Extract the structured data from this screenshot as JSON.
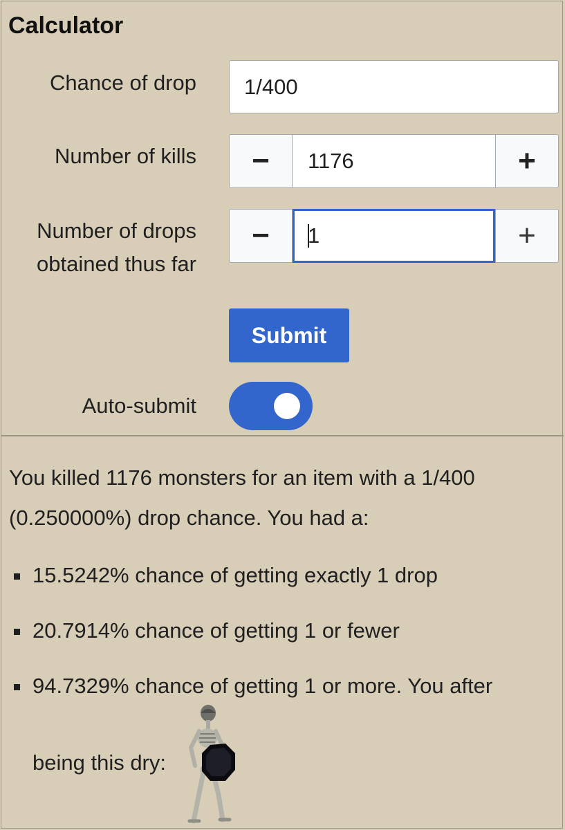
{
  "title": "Calculator",
  "form": {
    "chance_label": "Chance of drop",
    "chance_value": "1/400",
    "kills_label": "Number of kills",
    "kills_value": "1176",
    "drops_label_line1": "Number of drops",
    "drops_label_line2": "obtained thus far",
    "drops_value": "1",
    "minus_glyph": "−",
    "plus_glyph": "+",
    "submit_label": "Submit",
    "autosubmit_label": "Auto-submit",
    "autosubmit_on": true,
    "accent_color": "#3366cc"
  },
  "result": {
    "intro_line1": "You killed 1176 monsters for an item with a 1/400",
    "intro_line2": "(0.250000%) drop chance. You had a:",
    "bullets": [
      "15.5242% chance of getting exactly 1 drop",
      "20.7914% chance of getting 1 or fewer",
      "94.7329% chance of getting 1 or more. You after"
    ],
    "dry_text": "being this dry:",
    "image_icon": "skeleton-shield-figure"
  }
}
